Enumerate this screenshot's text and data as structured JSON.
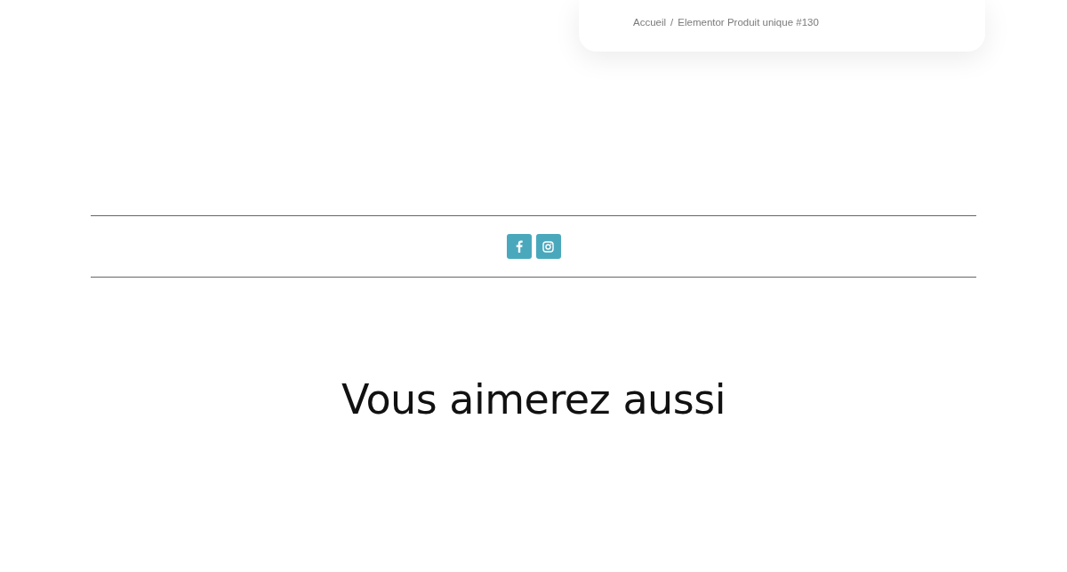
{
  "breadcrumb": {
    "items": [
      "Accueil",
      "Elementor Produit unique #130"
    ],
    "separator": "/"
  },
  "social_links": [
    {
      "kind": "facebook"
    },
    {
      "kind": "instagram"
    }
  ],
  "related_heading": "Vous aimerez aussi"
}
